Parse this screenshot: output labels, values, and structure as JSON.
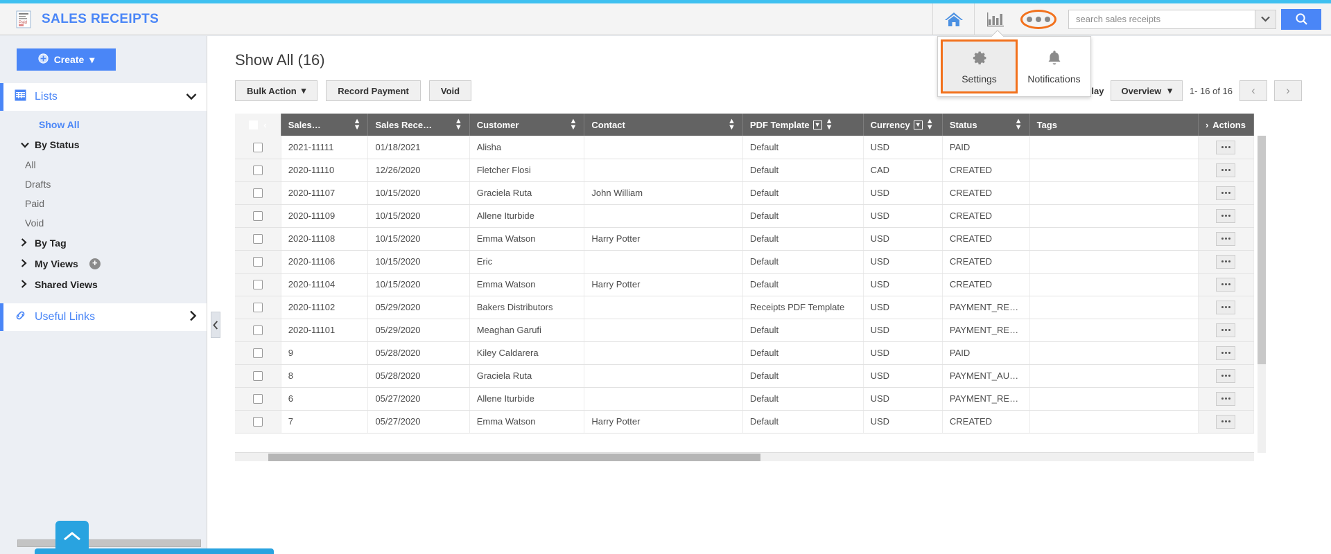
{
  "theme": {
    "accent": "#3fc0f0",
    "brand_blue": "#4a86f7",
    "highlight_orange": "#f2711c",
    "header_row": "#636363"
  },
  "header": {
    "title": "SALES RECEIPTS",
    "logo_icon": "receipt-icon",
    "home_icon": "home-icon",
    "reports_icon": "bar-chart-icon",
    "more_icon": "ellipsis-icon",
    "search": {
      "placeholder": "search sales receipts",
      "value": "",
      "dropdown_icon": "chevron-down-icon",
      "go_icon": "search-icon"
    }
  },
  "more_menu": {
    "items": [
      {
        "label": "Settings",
        "icon": "gear-icon",
        "active": true
      },
      {
        "label": "Notifications",
        "icon": "bell-icon",
        "active": false
      }
    ]
  },
  "sidebar": {
    "create_button": {
      "label": "Create",
      "icon": "plus-circle-icon",
      "caret": "▾"
    },
    "lists": {
      "label": "Lists",
      "icon": "grid-icon",
      "chevron": "⌄"
    },
    "show_all": "Show All",
    "by_status": {
      "label": "By Status",
      "caret": "⌄",
      "items": [
        "All",
        "Drafts",
        "Paid",
        "Void"
      ]
    },
    "by_tag": {
      "label": "By Tag",
      "caret": "›"
    },
    "my_views": {
      "label": "My Views",
      "caret": "›",
      "add_icon": "plus-circle-icon"
    },
    "shared_views": {
      "label": "Shared Views",
      "caret": "›"
    },
    "useful_links": {
      "label": "Useful Links",
      "icon": "link-icon",
      "chevron": "›"
    },
    "collapse_handle": "‹",
    "scroll_top_icon": "chevron-up-icon"
  },
  "main": {
    "page_title": "Show All (16)",
    "toolbar": {
      "bulk_action": "Bulk Action",
      "bulk_action_caret": "▾",
      "record_payment": "Record Payment",
      "void": "Void"
    },
    "display": {
      "label": "Display",
      "mode": "Overview",
      "mode_caret": "▾",
      "range": "1- 16 of 16",
      "prev_icon": "‹",
      "next_icon": "›"
    },
    "table": {
      "columns": [
        {
          "label": "",
          "key": "checkbox",
          "type": "checkbox",
          "collapse_icon": "‹"
        },
        {
          "label": "Sales…",
          "key": "sales_no",
          "sortable": true
        },
        {
          "label": "Sales Rece…",
          "key": "date",
          "sortable": true
        },
        {
          "label": "Customer",
          "key": "customer",
          "sortable": true
        },
        {
          "label": "Contact",
          "key": "contact",
          "sortable": true
        },
        {
          "label": "PDF Template",
          "key": "pdf_template",
          "sortable": true,
          "filter": true
        },
        {
          "label": "Currency",
          "key": "currency",
          "sortable": true,
          "filter": true
        },
        {
          "label": "Status",
          "key": "status",
          "sortable": true
        },
        {
          "label": "Tags",
          "key": "tags",
          "sortable": false
        },
        {
          "label": "Actions",
          "key": "actions",
          "expand_icon": "›"
        }
      ],
      "rows": [
        {
          "sales_no": "2021-11111",
          "date": "01/18/2021",
          "customer": "Alisha",
          "contact": "",
          "pdf_template": "Default",
          "currency": "USD",
          "status": "PAID",
          "tags": ""
        },
        {
          "sales_no": "2020-11110",
          "date": "12/26/2020",
          "customer": "Fletcher Flosi",
          "contact": "",
          "pdf_template": "Default",
          "currency": "CAD",
          "status": "CREATED",
          "tags": ""
        },
        {
          "sales_no": "2020-11107",
          "date": "10/15/2020",
          "customer": "Graciela Ruta",
          "contact": "John William",
          "pdf_template": "Default",
          "currency": "USD",
          "status": "CREATED",
          "tags": ""
        },
        {
          "sales_no": "2020-11109",
          "date": "10/15/2020",
          "customer": "Allene Iturbide",
          "contact": "",
          "pdf_template": "Default",
          "currency": "USD",
          "status": "CREATED",
          "tags": ""
        },
        {
          "sales_no": "2020-11108",
          "date": "10/15/2020",
          "customer": "Emma Watson",
          "contact": "Harry Potter",
          "pdf_template": "Default",
          "currency": "USD",
          "status": "CREATED",
          "tags": ""
        },
        {
          "sales_no": "2020-11106",
          "date": "10/15/2020",
          "customer": "Eric",
          "contact": "",
          "pdf_template": "Default",
          "currency": "USD",
          "status": "CREATED",
          "tags": ""
        },
        {
          "sales_no": "2020-11104",
          "date": "10/15/2020",
          "customer": "Emma Watson",
          "contact": "Harry Potter",
          "pdf_template": "Default",
          "currency": "USD",
          "status": "CREATED",
          "tags": ""
        },
        {
          "sales_no": "2020-11102",
          "date": "05/29/2020",
          "customer": "Bakers Distributors",
          "contact": "",
          "pdf_template": "Receipts PDF Template",
          "currency": "USD",
          "status": "PAYMENT_REC…",
          "tags": ""
        },
        {
          "sales_no": "2020-11101",
          "date": "05/29/2020",
          "customer": "Meaghan Garufi",
          "contact": "",
          "pdf_template": "Default",
          "currency": "USD",
          "status": "PAYMENT_REC…",
          "tags": ""
        },
        {
          "sales_no": "9",
          "date": "05/28/2020",
          "customer": "Kiley Caldarera",
          "contact": "",
          "pdf_template": "Default",
          "currency": "USD",
          "status": "PAID",
          "tags": ""
        },
        {
          "sales_no": "8",
          "date": "05/28/2020",
          "customer": "Graciela Ruta",
          "contact": "",
          "pdf_template": "Default",
          "currency": "USD",
          "status": "PAYMENT_AUTH…",
          "tags": ""
        },
        {
          "sales_no": "6",
          "date": "05/27/2020",
          "customer": "Allene Iturbide",
          "contact": "",
          "pdf_template": "Default",
          "currency": "USD",
          "status": "PAYMENT_REC…",
          "tags": ""
        },
        {
          "sales_no": "7",
          "date": "05/27/2020",
          "customer": "Emma Watson",
          "contact": "Harry Potter",
          "pdf_template": "Default",
          "currency": "USD",
          "status": "CREATED",
          "tags": ""
        }
      ],
      "row_action_icon": "ellipsis-icon"
    }
  }
}
